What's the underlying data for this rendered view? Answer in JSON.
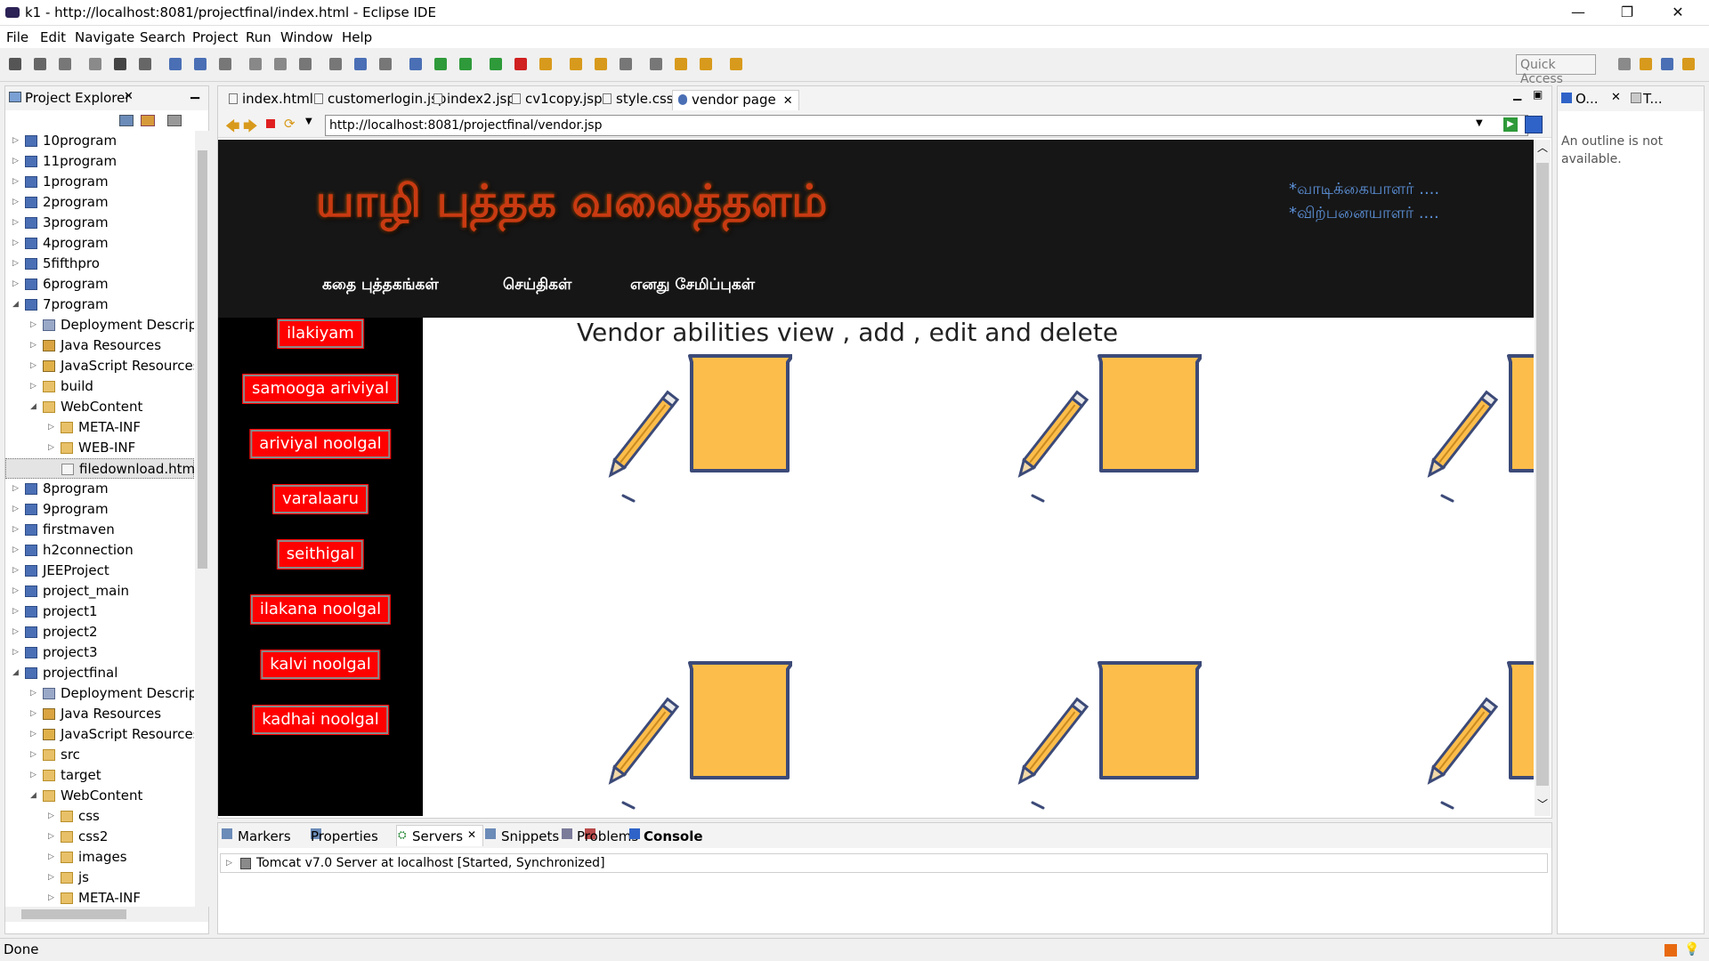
{
  "window": {
    "title": "k1 - http://localhost:8081/projectfinal/index.html - Eclipse IDE",
    "minimize": "—",
    "restore": "❐",
    "close": "✕"
  },
  "menu": [
    "File",
    "Edit",
    "Navigate",
    "Search",
    "Project",
    "Run",
    "Window",
    "Help"
  ],
  "toolbar": {
    "quick_access": "Quick Access"
  },
  "project_explorer": {
    "title": "Project Explorer",
    "close": "✕",
    "items": [
      {
        "label": "10program",
        "depth": 0,
        "open": false,
        "icon": "project"
      },
      {
        "label": "11program",
        "depth": 0,
        "open": false,
        "icon": "project"
      },
      {
        "label": "1program",
        "depth": 0,
        "open": false,
        "icon": "project"
      },
      {
        "label": "2program",
        "depth": 0,
        "open": false,
        "icon": "project"
      },
      {
        "label": "3program",
        "depth": 0,
        "open": false,
        "icon": "project"
      },
      {
        "label": "4program",
        "depth": 0,
        "open": false,
        "icon": "project"
      },
      {
        "label": "5fifthpro",
        "depth": 0,
        "open": false,
        "icon": "project"
      },
      {
        "label": "6program",
        "depth": 0,
        "open": false,
        "icon": "project"
      },
      {
        "label": "7program",
        "depth": 0,
        "open": true,
        "icon": "project"
      },
      {
        "label": "Deployment Descriptor",
        "depth": 1,
        "open": false,
        "icon": "descriptor"
      },
      {
        "label": "Java Resources",
        "depth": 1,
        "open": false,
        "icon": "java"
      },
      {
        "label": "JavaScript Resources",
        "depth": 1,
        "open": false,
        "icon": "js"
      },
      {
        "label": "build",
        "depth": 1,
        "open": false,
        "icon": "folder"
      },
      {
        "label": "WebContent",
        "depth": 1,
        "open": true,
        "icon": "folder"
      },
      {
        "label": "META-INF",
        "depth": 2,
        "open": false,
        "icon": "folder"
      },
      {
        "label": "WEB-INF",
        "depth": 2,
        "open": false,
        "icon": "folder"
      },
      {
        "label": "filedownload.html",
        "depth": 2,
        "open": null,
        "icon": "file",
        "selected": true
      },
      {
        "label": "8program",
        "depth": 0,
        "open": false,
        "icon": "project"
      },
      {
        "label": "9program",
        "depth": 0,
        "open": false,
        "icon": "project"
      },
      {
        "label": "firstmaven",
        "depth": 0,
        "open": false,
        "icon": "project"
      },
      {
        "label": "h2connection",
        "depth": 0,
        "open": false,
        "icon": "project"
      },
      {
        "label": "JEEProject",
        "depth": 0,
        "open": false,
        "icon": "project"
      },
      {
        "label": "project_main",
        "depth": 0,
        "open": false,
        "icon": "project"
      },
      {
        "label": "project1",
        "depth": 0,
        "open": false,
        "icon": "project"
      },
      {
        "label": "project2",
        "depth": 0,
        "open": false,
        "icon": "project"
      },
      {
        "label": "project3",
        "depth": 0,
        "open": false,
        "icon": "project"
      },
      {
        "label": "projectfinal",
        "depth": 0,
        "open": true,
        "icon": "project"
      },
      {
        "label": "Deployment Descriptor",
        "depth": 1,
        "open": false,
        "icon": "descriptor"
      },
      {
        "label": "Java Resources",
        "depth": 1,
        "open": false,
        "icon": "java"
      },
      {
        "label": "JavaScript Resources",
        "depth": 1,
        "open": false,
        "icon": "js"
      },
      {
        "label": "src",
        "depth": 1,
        "open": false,
        "icon": "folder"
      },
      {
        "label": "target",
        "depth": 1,
        "open": false,
        "icon": "folder"
      },
      {
        "label": "WebContent",
        "depth": 1,
        "open": true,
        "icon": "folder"
      },
      {
        "label": "css",
        "depth": 2,
        "open": false,
        "icon": "folder"
      },
      {
        "label": "css2",
        "depth": 2,
        "open": false,
        "icon": "folder"
      },
      {
        "label": "images",
        "depth": 2,
        "open": false,
        "icon": "folder"
      },
      {
        "label": "js",
        "depth": 2,
        "open": false,
        "icon": "folder"
      },
      {
        "label": "META-INF",
        "depth": 2,
        "open": false,
        "icon": "folder"
      }
    ]
  },
  "editor": {
    "tabs": [
      {
        "label": "index.html",
        "active": false
      },
      {
        "label": "customerlogin.jsp",
        "active": false
      },
      {
        "label": "index2.jsp",
        "active": false
      },
      {
        "label": "cv1copy.jsp",
        "active": false
      },
      {
        "label": "style.css",
        "active": false
      },
      {
        "label": "vendor page",
        "active": true
      }
    ],
    "tab_close": "✕",
    "url": "http://localhost:8081/projectfinal/vendor.jsp"
  },
  "webpage": {
    "brand": "யாழி புத்தக வலைத்தளம்",
    "nav": [
      "கதை புத்தகங்கள்",
      "செய்திகள்",
      "எனது சேமிப்புகள்"
    ],
    "right_links": [
      "*வாடிக்கையாளர் ....",
      "*விற்பனையாளர் ...."
    ],
    "side_buttons": [
      "ilakiyam",
      "samooga ariviyal",
      "ariviyal noolgal",
      "varalaaru",
      "seithigal",
      "ilakana noolgal",
      "kalvi noolgal",
      "kadhai noolgal"
    ],
    "heading": "Vendor abilities view , add , edit and delete",
    "colors": {
      "header_bg": "#161616",
      "button_red": "#ff0000",
      "note_fill": "#fdbd4a",
      "outline": "#3c4a78"
    }
  },
  "bottom_panel": {
    "tabs": [
      "Markers",
      "Properties",
      "Servers",
      "Snippets",
      "Problems",
      "Console"
    ],
    "active_tab": "Servers",
    "server_row": "Tomcat v7.0 Server at localhost  [Started, Synchronized]"
  },
  "outline": {
    "tabs": [
      "O...",
      "T..."
    ],
    "message": "An outline is not available."
  },
  "status": {
    "text": "Done"
  }
}
